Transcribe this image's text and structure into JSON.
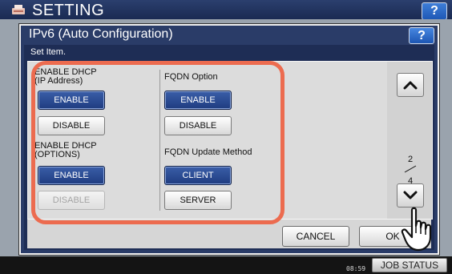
{
  "background": {
    "title": "SETTING",
    "help_label": "?",
    "time": "08:59",
    "job_status_label": "JOB STATUS"
  },
  "dialog": {
    "title": "IPv6 (Auto Configuration)",
    "help_label": "?",
    "subtitle": "Set Item.",
    "left_column": {
      "group1_label_line1": "ENABLE DHCP",
      "group1_label_line2": "(IP Address)",
      "group1_enable": "ENABLE",
      "group1_disable": "DISABLE",
      "group1_selected": "ENABLE",
      "group2_label_line1": "ENABLE DHCP",
      "group2_label_line2": "(OPTIONS)",
      "group2_enable": "ENABLE",
      "group2_disable": "DISABLE",
      "group2_selected": "ENABLE",
      "group2_disable_state": "disabled"
    },
    "right_column": {
      "group1_label": "FQDN Option",
      "group1_enable": "ENABLE",
      "group1_disable": "DISABLE",
      "group1_selected": "ENABLE",
      "group2_label": "FQDN Update Method",
      "group2_client": "CLIENT",
      "group2_server": "SERVER",
      "group2_selected": "CLIENT"
    },
    "pagination": {
      "current": "2",
      "total": "4"
    },
    "cancel_label": "CANCEL",
    "ok_label": "OK"
  },
  "colors": {
    "accent_highlight": "#ec6b4f",
    "selected_button": "#2a4b94",
    "dialog_frame": "#2a3c68"
  },
  "icons": {
    "scroll_up": "chevron-up-icon",
    "scroll_down": "chevron-down-icon",
    "pointer": "hand-pointer-icon",
    "logo": "printer-logo-icon"
  }
}
